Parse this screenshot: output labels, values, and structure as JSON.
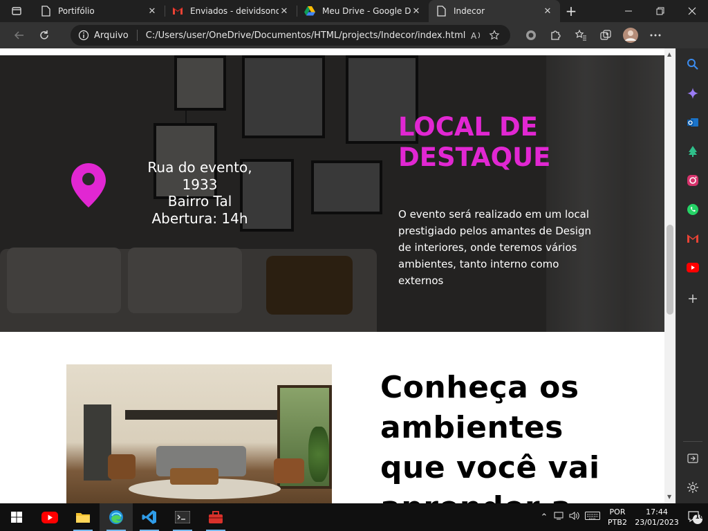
{
  "browser": {
    "tabs": [
      {
        "title": "Portifólio",
        "icon": "page-icon",
        "active": false
      },
      {
        "title": "Enviados - deividsonorr",
        "icon": "gmail-icon",
        "active": false
      },
      {
        "title": "Meu Drive - Google Driv",
        "icon": "google-drive-icon",
        "active": false
      },
      {
        "title": "Indecor",
        "icon": "page-icon",
        "active": true
      }
    ],
    "new_tab_symbol": "+",
    "address_protocol": "Arquivo",
    "address_url": "C:/Users/user/OneDrive/Documentos/HTML/projects/Indecor/index.html"
  },
  "page": {
    "hero": {
      "address_lines": [
        "Rua do evento,",
        "1933",
        "Bairro Tal",
        "Abertura: 14h"
      ],
      "title_lines": [
        "LOCAL DE",
        "DESTAQUE"
      ],
      "description": "O evento será realizado em um local prestigiado pelos amantes de Design de interiores, onde teremos vários ambientes, tanto interno como externos",
      "accent_color": "#e127d2"
    },
    "ambientes": {
      "title": "Conheça os ambientes que você vai aprender a"
    }
  },
  "taskbar": {
    "language_line1": "POR",
    "language_line2": "PTB2",
    "time": "17:44",
    "date": "23/01/2023",
    "notification_count": "10"
  }
}
